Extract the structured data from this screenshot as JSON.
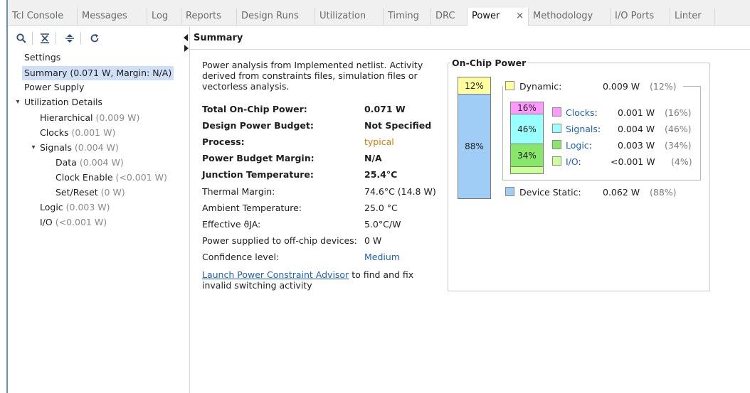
{
  "tabs": [
    {
      "label": "Tcl Console"
    },
    {
      "label": "Messages"
    },
    {
      "label": "Log"
    },
    {
      "label": "Reports"
    },
    {
      "label": "Design Runs"
    },
    {
      "label": "Utilization"
    },
    {
      "label": "Timing"
    },
    {
      "label": "DRC"
    },
    {
      "label": "Power",
      "active": true
    },
    {
      "label": "Methodology"
    },
    {
      "label": "I/O Ports"
    },
    {
      "label": "Linter"
    }
  ],
  "tab_close": "×",
  "toolbar": {
    "icons": [
      "search-icon",
      "collapse-all-icon",
      "expand-all-icon",
      "refresh-icon"
    ]
  },
  "tree": {
    "settings": "Settings",
    "summary": "Summary (0.071 W, Margin: N/A)",
    "power_supply": "Power Supply",
    "utilization_details": "Utilization Details",
    "hierarchical": {
      "label": "Hierarchical",
      "value": "(0.009 W)"
    },
    "clocks": {
      "label": "Clocks",
      "value": "(0.001 W)"
    },
    "signals": {
      "label": "Signals",
      "value": "(0.004 W)"
    },
    "data": {
      "label": "Data",
      "value": "(0.004 W)"
    },
    "clock_enable": {
      "label": "Clock Enable",
      "value": "(<0.001 W)"
    },
    "set_reset": {
      "label": "Set/Reset",
      "value": "(0 W)"
    },
    "logic": {
      "label": "Logic",
      "value": "(0.003 W)"
    },
    "io": {
      "label": "I/O",
      "value": "(<0.001 W)"
    }
  },
  "content": {
    "header": "Summary",
    "description": "Power analysis from Implemented netlist. Activity derived from constraints files, simulation files or vectorless analysis.",
    "rows": [
      {
        "label": "Total On-Chip Power:",
        "value": "0.071 W"
      },
      {
        "label": "Design Power Budget:",
        "value": "Not Specified"
      },
      {
        "label": "Process:",
        "value": "typical"
      },
      {
        "label": "Power Budget Margin:",
        "value": "N/A"
      },
      {
        "label": "Junction Temperature:",
        "value": "25.4°C"
      },
      {
        "label": "Thermal Margin:",
        "value": "74.6°C (14.8 W)"
      },
      {
        "label": "Ambient Temperature:",
        "value": "25.0 °C"
      },
      {
        "label": "Effective ϑJA:",
        "value": "5.0°C/W"
      },
      {
        "label": "Power supplied to off-chip devices:",
        "value": "0 W"
      },
      {
        "label": "Confidence level:",
        "value": "Medium"
      }
    ],
    "footer_link": "Launch Power Constraint Advisor",
    "footer_text": " to find and fix invalid switching activity"
  },
  "on_chip_power": {
    "title": "On-Chip Power",
    "colors": {
      "dynamic": "#ffffa0",
      "static": "#a0cdf5",
      "clocks": "#ff99ff",
      "signals": "#99ffff",
      "logic": "#88e668",
      "io": "#ccff99"
    },
    "outer_bar": {
      "dynamic_pct": "12%",
      "static_pct": "88%"
    },
    "inner_bar": {
      "clocks_pct": "16%",
      "signals_pct": "46%",
      "logic_pct": "34%"
    },
    "dynamic": {
      "label": "Dynamic:",
      "value": "0.009 W",
      "pct": "(12%)"
    },
    "clocks": {
      "label": "Clocks",
      "value": "0.001 W",
      "pct": "(16%)"
    },
    "signals": {
      "label": "Signals",
      "value": "0.004 W",
      "pct": "(46%)"
    },
    "logic": {
      "label": "Logic",
      "value": "0.003 W",
      "pct": "(34%)"
    },
    "io": {
      "label": "I/O",
      "value": "<0.001 W",
      "pct": "(4%)"
    },
    "device_static": {
      "label": "Device Static:",
      "value": "0.062 W",
      "pct": "(88%)"
    }
  }
}
